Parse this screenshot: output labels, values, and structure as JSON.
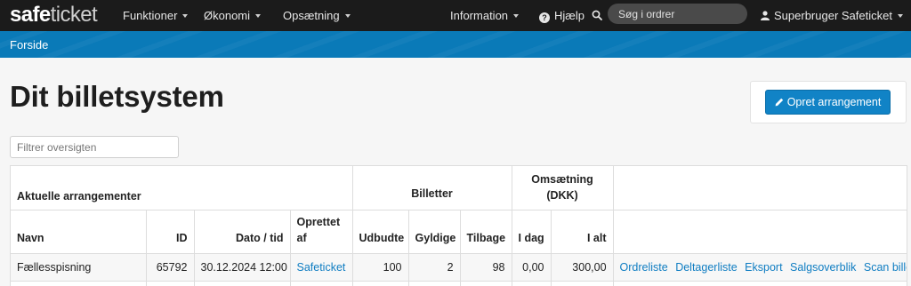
{
  "navbar": {
    "brand_part1": "safe",
    "brand_part2": "ticket",
    "menu": [
      {
        "label": "Funktioner"
      },
      {
        "label": "Økonomi"
      },
      {
        "label": "Opsætning"
      }
    ],
    "information_label": "Information",
    "help_label": "Hjælp",
    "search_placeholder": "Søg i ordrer",
    "user_label": "Superbruger Safeticket"
  },
  "breadcrumb": {
    "home": "Forside"
  },
  "page": {
    "title": "Dit billetsystem",
    "create_button": "Opret arrangement",
    "filter_placeholder": "Filtrer oversigten"
  },
  "table": {
    "group_headers": {
      "events": "Aktuelle arrangementer",
      "tickets": "Billetter",
      "revenue_line1": "Omsætning",
      "revenue_line2": "(DKK)"
    },
    "columns": {
      "name": "Navn",
      "id": "ID",
      "date": "Dato / tid",
      "created_by_line1": "Oprettet",
      "created_by_line2": "af",
      "offered": "Udbudte",
      "valid": "Gyldige",
      "refund": "Tilbage",
      "today": "I dag",
      "total": "I alt"
    },
    "rows": [
      {
        "name": "Fællesspisning",
        "id": "65792",
        "date": "30.12.2024 12:00",
        "created_by": "Safeticket",
        "offered": "100",
        "valid": "2",
        "refund": "98",
        "today": "0,00",
        "total": "300,00",
        "actions": [
          "Ordreliste",
          "Deltagerliste",
          "Eksport",
          "Salgsoverblik",
          "Scan billet"
        ]
      }
    ]
  },
  "colors": {
    "navbar_bg": "#1b1b1b",
    "subbar_bg": "#0a7ab8",
    "primary_button": "#1183c6",
    "link": "#0f7dc2"
  }
}
